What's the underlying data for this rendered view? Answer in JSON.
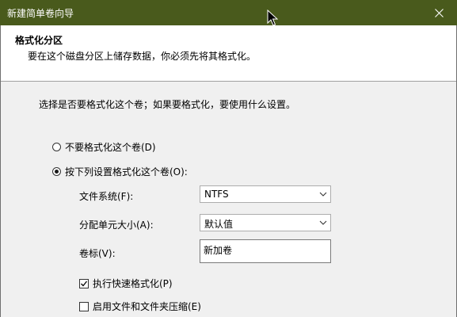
{
  "window": {
    "title": "新建简单卷向导"
  },
  "header": {
    "title": "格式化分区",
    "description": "要在这个磁盘分区上储存数据，你必须先将其格式化。"
  },
  "body": {
    "instruction": "选择是否要格式化这个卷；如果要格式化，要使用什么设置。",
    "options": {
      "no_format": {
        "label": "不要格式化这个卷(D)",
        "checked": false
      },
      "format": {
        "label": "按下列设置格式化这个卷(O):",
        "checked": true
      }
    },
    "fields": {
      "filesystem": {
        "label": "文件系统(F):",
        "value": "NTFS"
      },
      "allocation": {
        "label": "分配单元大小(A):",
        "value": "默认值"
      },
      "volume_label": {
        "label": "卷标(V):",
        "value": "新加卷"
      }
    },
    "checks": {
      "quick_format": {
        "label": "执行快速格式化(P)",
        "checked": true
      },
      "compression": {
        "label": "启用文件和文件夹压缩(E)",
        "checked": false
      }
    }
  },
  "colors": {
    "titlebar": "#495a1c",
    "background": "#f0f0f0"
  },
  "icons": {
    "close": "close-icon",
    "cursor": "mouse-cursor-icon",
    "dropdown": "chevron-down-icon"
  }
}
